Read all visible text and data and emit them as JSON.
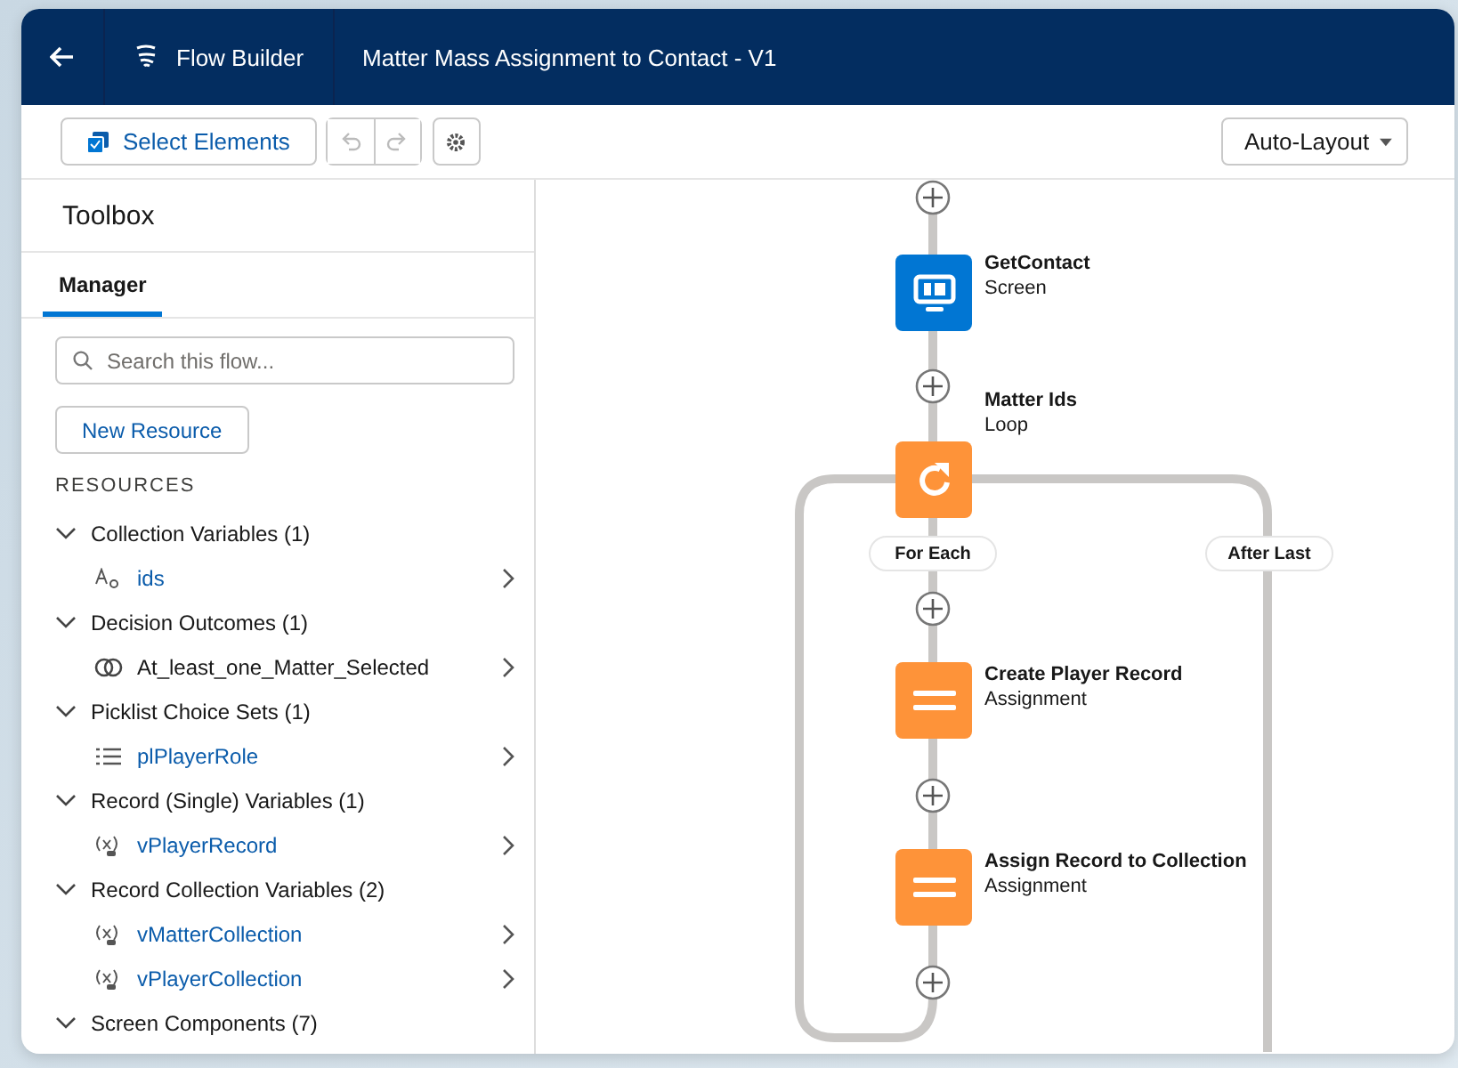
{
  "header": {
    "app_name": "Flow Builder",
    "flow_title": "Matter Mass Assignment to Contact - V1"
  },
  "toolbar": {
    "select_button": "Select Elements",
    "layout_dropdown": "Auto-Layout"
  },
  "sidebar": {
    "title": "Toolbox",
    "tabs": [
      {
        "label": "Manager",
        "selected": true
      }
    ],
    "search": {
      "placeholder": "Search this flow..."
    },
    "new_resource_button": "New Resource",
    "section_label": "RESOURCES",
    "groups": [
      {
        "label": "Collection Variables (1)",
        "expanded": true,
        "items": [
          {
            "name": "ids",
            "kind": "text"
          }
        ]
      },
      {
        "label": "Decision Outcomes (1)",
        "expanded": true,
        "items": [
          {
            "name": "At_least_one_Matter_Selected",
            "kind": "outcome"
          }
        ]
      },
      {
        "label": "Picklist Choice Sets (1)",
        "expanded": true,
        "items": [
          {
            "name": "plPlayerRole",
            "kind": "picklist"
          }
        ]
      },
      {
        "label": "Record (Single) Variables (1)",
        "expanded": true,
        "items": [
          {
            "name": "vPlayerRecord",
            "kind": "record"
          }
        ]
      },
      {
        "label": "Record Collection Variables (2)",
        "expanded": true,
        "items": [
          {
            "name": "vMatterCollection",
            "kind": "record"
          },
          {
            "name": "vPlayerCollection",
            "kind": "record"
          }
        ]
      },
      {
        "label": "Screen Components (7)",
        "expanded": true
      }
    ]
  },
  "canvas": {
    "nodes": [
      {
        "title": "GetContact",
        "type": "Screen",
        "kind": "screen"
      },
      {
        "title": "Matter Ids",
        "type": "Loop",
        "kind": "loop"
      },
      {
        "title": "Create Player Record",
        "type": "Assignment",
        "kind": "assignment"
      },
      {
        "title": "Assign Record to Collection",
        "type": "Assignment",
        "kind": "assignment"
      }
    ],
    "branch_labels": [
      "For Each",
      "After Last"
    ]
  }
}
